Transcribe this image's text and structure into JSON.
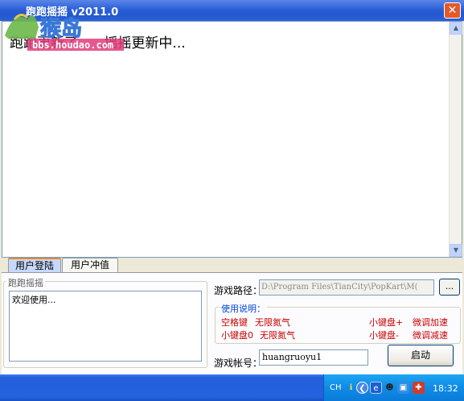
{
  "window": {
    "title": "跑跑摇摇 v2011.0",
    "watermark_brand": "猴岛",
    "watermark_url": "bbs.houdao.com"
  },
  "main": {
    "news_text": "跑跑更新了......摇摇更新中..."
  },
  "tabs": [
    {
      "label": "用户登陆",
      "active": true
    },
    {
      "label": "用户冲值",
      "active": false
    }
  ],
  "login": {
    "group_title": "跑跑摇摇",
    "welcome_text": "欢迎使用...",
    "path_label": "游戏路径：",
    "path_value": "D:\\Program Files\\TianCity\\PopKart\\M(",
    "browse_label": "...",
    "help_title": "使用说明：",
    "help": {
      "space_key": "空格键",
      "unlimited_nitro_1": "无限氮气",
      "keypad_plus": "小键盘+",
      "fine_accel": "微调加速",
      "keypad_0": "小键盘0",
      "unlimited_nitro_2": "无限氮气",
      "keypad_minus": "小键盘-",
      "fine_decel": "微调减速"
    },
    "account_label": "游戏帐号：",
    "account_value": "huangruoyu1",
    "start_label": "启动"
  },
  "taskbar": {
    "lang": "CH",
    "clock": "18:32"
  },
  "icons": [
    "close-icon",
    "scroll-up-icon",
    "scroll-down-icon",
    "help-icon",
    "back-icon",
    "browser-icon",
    "qq-icon",
    "network-icon",
    "antivirus-icon"
  ],
  "colors": {
    "titlebar": "#2a5fd8",
    "help_text": "#c80000",
    "help_title": "#0046d5",
    "taskbar": "#245edb",
    "tray": "#0f8be6",
    "active_tab_accent": "#e68b2c"
  }
}
